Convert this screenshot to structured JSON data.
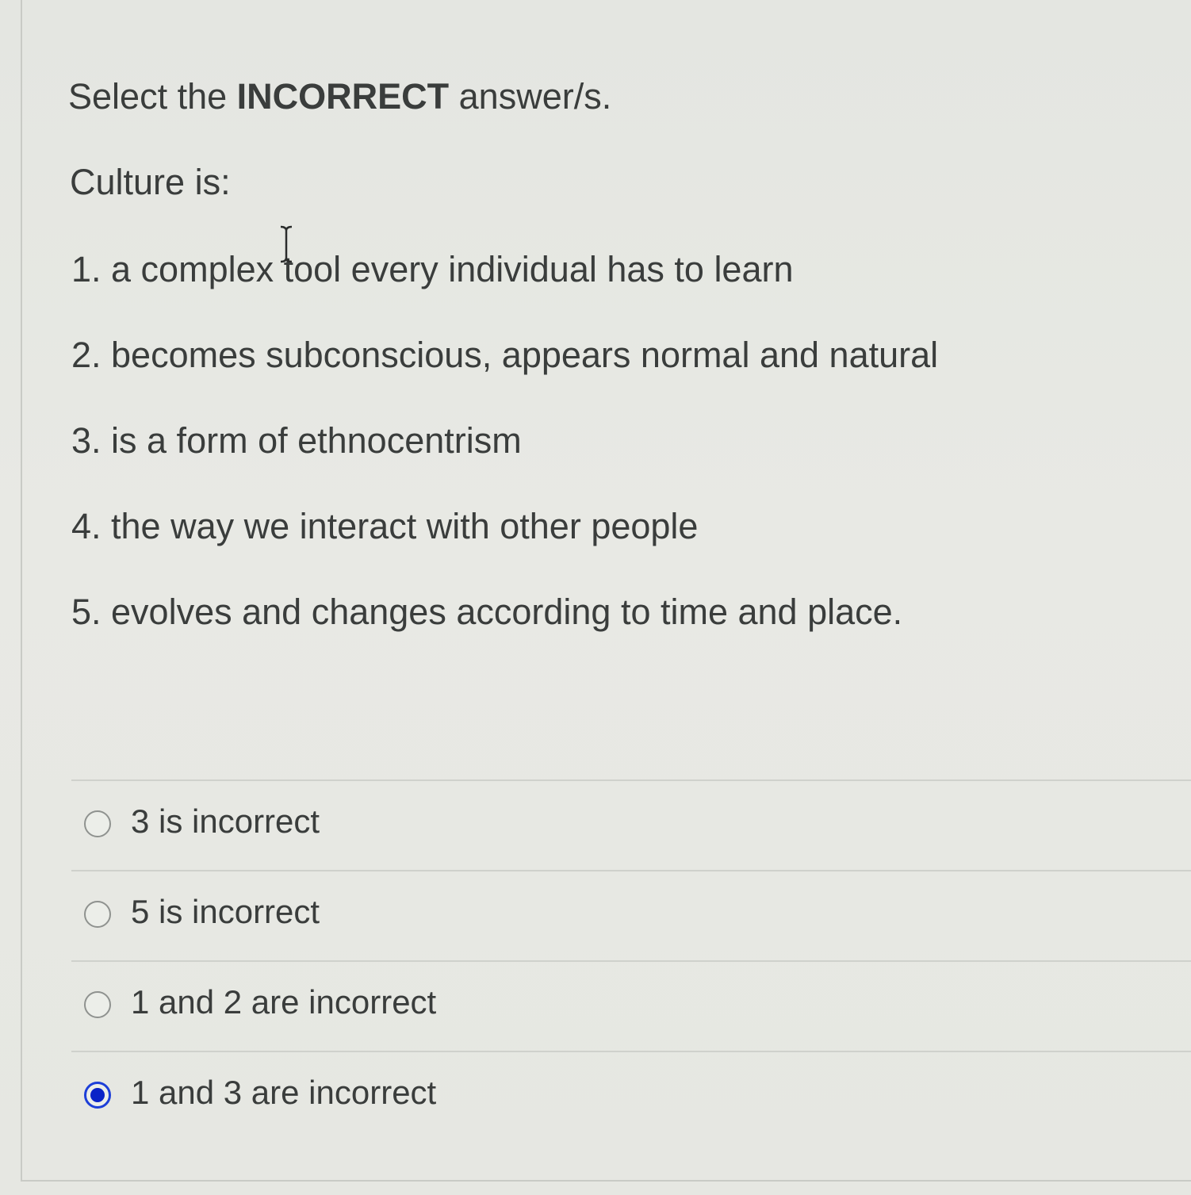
{
  "question": {
    "instruction_prefix": "Select the ",
    "instruction_emphasis": "INCORRECT",
    "instruction_suffix": " answer/s.",
    "stem": "Culture is:",
    "statements": [
      "1. a complex tool every individual has to learn",
      "2. becomes subconscious, appears normal and natural",
      "3. is a form of ethnocentrism",
      "4. the way we interact with other people",
      "5. evolves and changes according to time and place."
    ]
  },
  "options": [
    {
      "label": "3 is incorrect",
      "selected": false
    },
    {
      "label": "5 is incorrect",
      "selected": false
    },
    {
      "label": "1 and 2 are incorrect",
      "selected": false
    },
    {
      "label": "1 and 3 are incorrect",
      "selected": true
    }
  ],
  "colors": {
    "background": "#e6e7e2",
    "text": "#3a3d3c",
    "radio_selected": "#0a23c7",
    "radio_border": "#8f928f",
    "divider": "#cfd1cc"
  },
  "cursor": {
    "icon": "text-cursor-icon"
  }
}
